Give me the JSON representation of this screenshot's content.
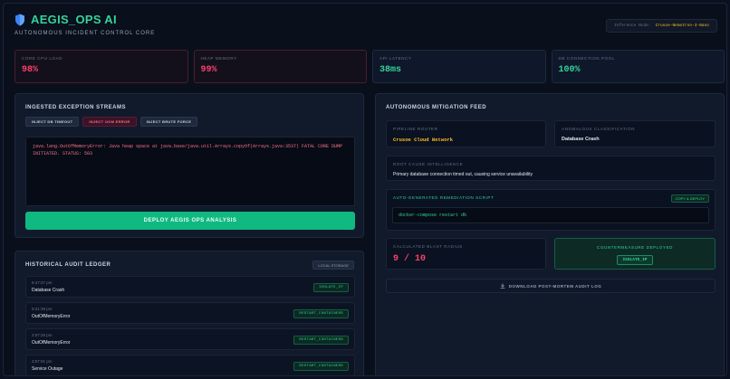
{
  "app": {
    "title": "AEGIS_OPS AI",
    "subtitle": "AUTONOMOUS INCIDENT CONTROL CORE",
    "node_label": "Inference Node:",
    "node_value": "Crusoe-Nemotron-3-Nano"
  },
  "metrics": [
    {
      "label": "CORE CPU LOAD",
      "value": "98%",
      "status": "critical"
    },
    {
      "label": "HEAP MEMORY",
      "value": "99%",
      "status": "critical"
    },
    {
      "label": "API LATENCY",
      "value": "38ms",
      "status": "ok"
    },
    {
      "label": "DB CONNECTION POOL",
      "value": "100%",
      "status": "ok"
    }
  ],
  "ingest": {
    "title": "INGESTED EXCEPTION STREAMS",
    "buttons": [
      "INJECT DB TIMEOUT",
      "INJECT OOM ERROR",
      "INJECT BRUTE FORCE"
    ],
    "active_button": "INJECT OOM ERROR",
    "log": "java.lang.OutOfMemoryError: Java heap space at java.base/java.util.Arrays.copyOf(Arrays.java:3537) FATAL CORE DUMP INITIATED. STATUS: 503",
    "deploy_label": "DEPLOY AEGIS OPS ANALYSIS"
  },
  "ledger": {
    "title": "HISTORICAL AUDIT LEDGER",
    "storage_label": "LOCAL STORAGE",
    "items": [
      {
        "time": "8:47:27 pm",
        "title": "Database Crash",
        "action": "ISOLATE_IP"
      },
      {
        "time": "8:21:38 pm",
        "title": "OutOfMemoryError",
        "action": "RESTART_CONTAINERS"
      },
      {
        "time": "3:57:29 pm",
        "title": "OutOfMemoryError",
        "action": "RESTART_CONTAINERS"
      },
      {
        "time": "3:57:01 pm",
        "title": "Service Outage",
        "action": "RESTART_CONTAINERS"
      }
    ]
  },
  "mitigation": {
    "title": "AUTONOMOUS MITIGATION FEED",
    "pipeline_label": "PIPELINE ROUTER",
    "pipeline_value": "Crusoe Cloud Network",
    "classification_label": "ANOMALOUS CLASSIFICATION",
    "classification_value": "Database Crash",
    "root_cause_label": "ROOT CAUSE INTELLIGENCE",
    "root_cause_value": "Primary database connection timed out, causing service unavailability",
    "script_label": "AUTO-GENERATED REMEDIATION SCRIPT",
    "copy_label": "COPY & DEPLOY",
    "script": "docker-compose restart db",
    "blast_label": "CALCULATED BLAST RADIUS",
    "blast_value": "9 / 10",
    "counter_label": "COUNTERMEASURE DEPLOYED",
    "counter_value": "ISOLATE_IP",
    "download_label": "DOWNLOAD POST-MORTEM AUDIT LOG"
  },
  "colors": {
    "accent": "#34d399",
    "critical": "#fb3f6a",
    "amber": "#fbbf24",
    "background": "#0a0f1c"
  },
  "icons": {
    "brand": "shield-icon",
    "download": "download-icon"
  }
}
